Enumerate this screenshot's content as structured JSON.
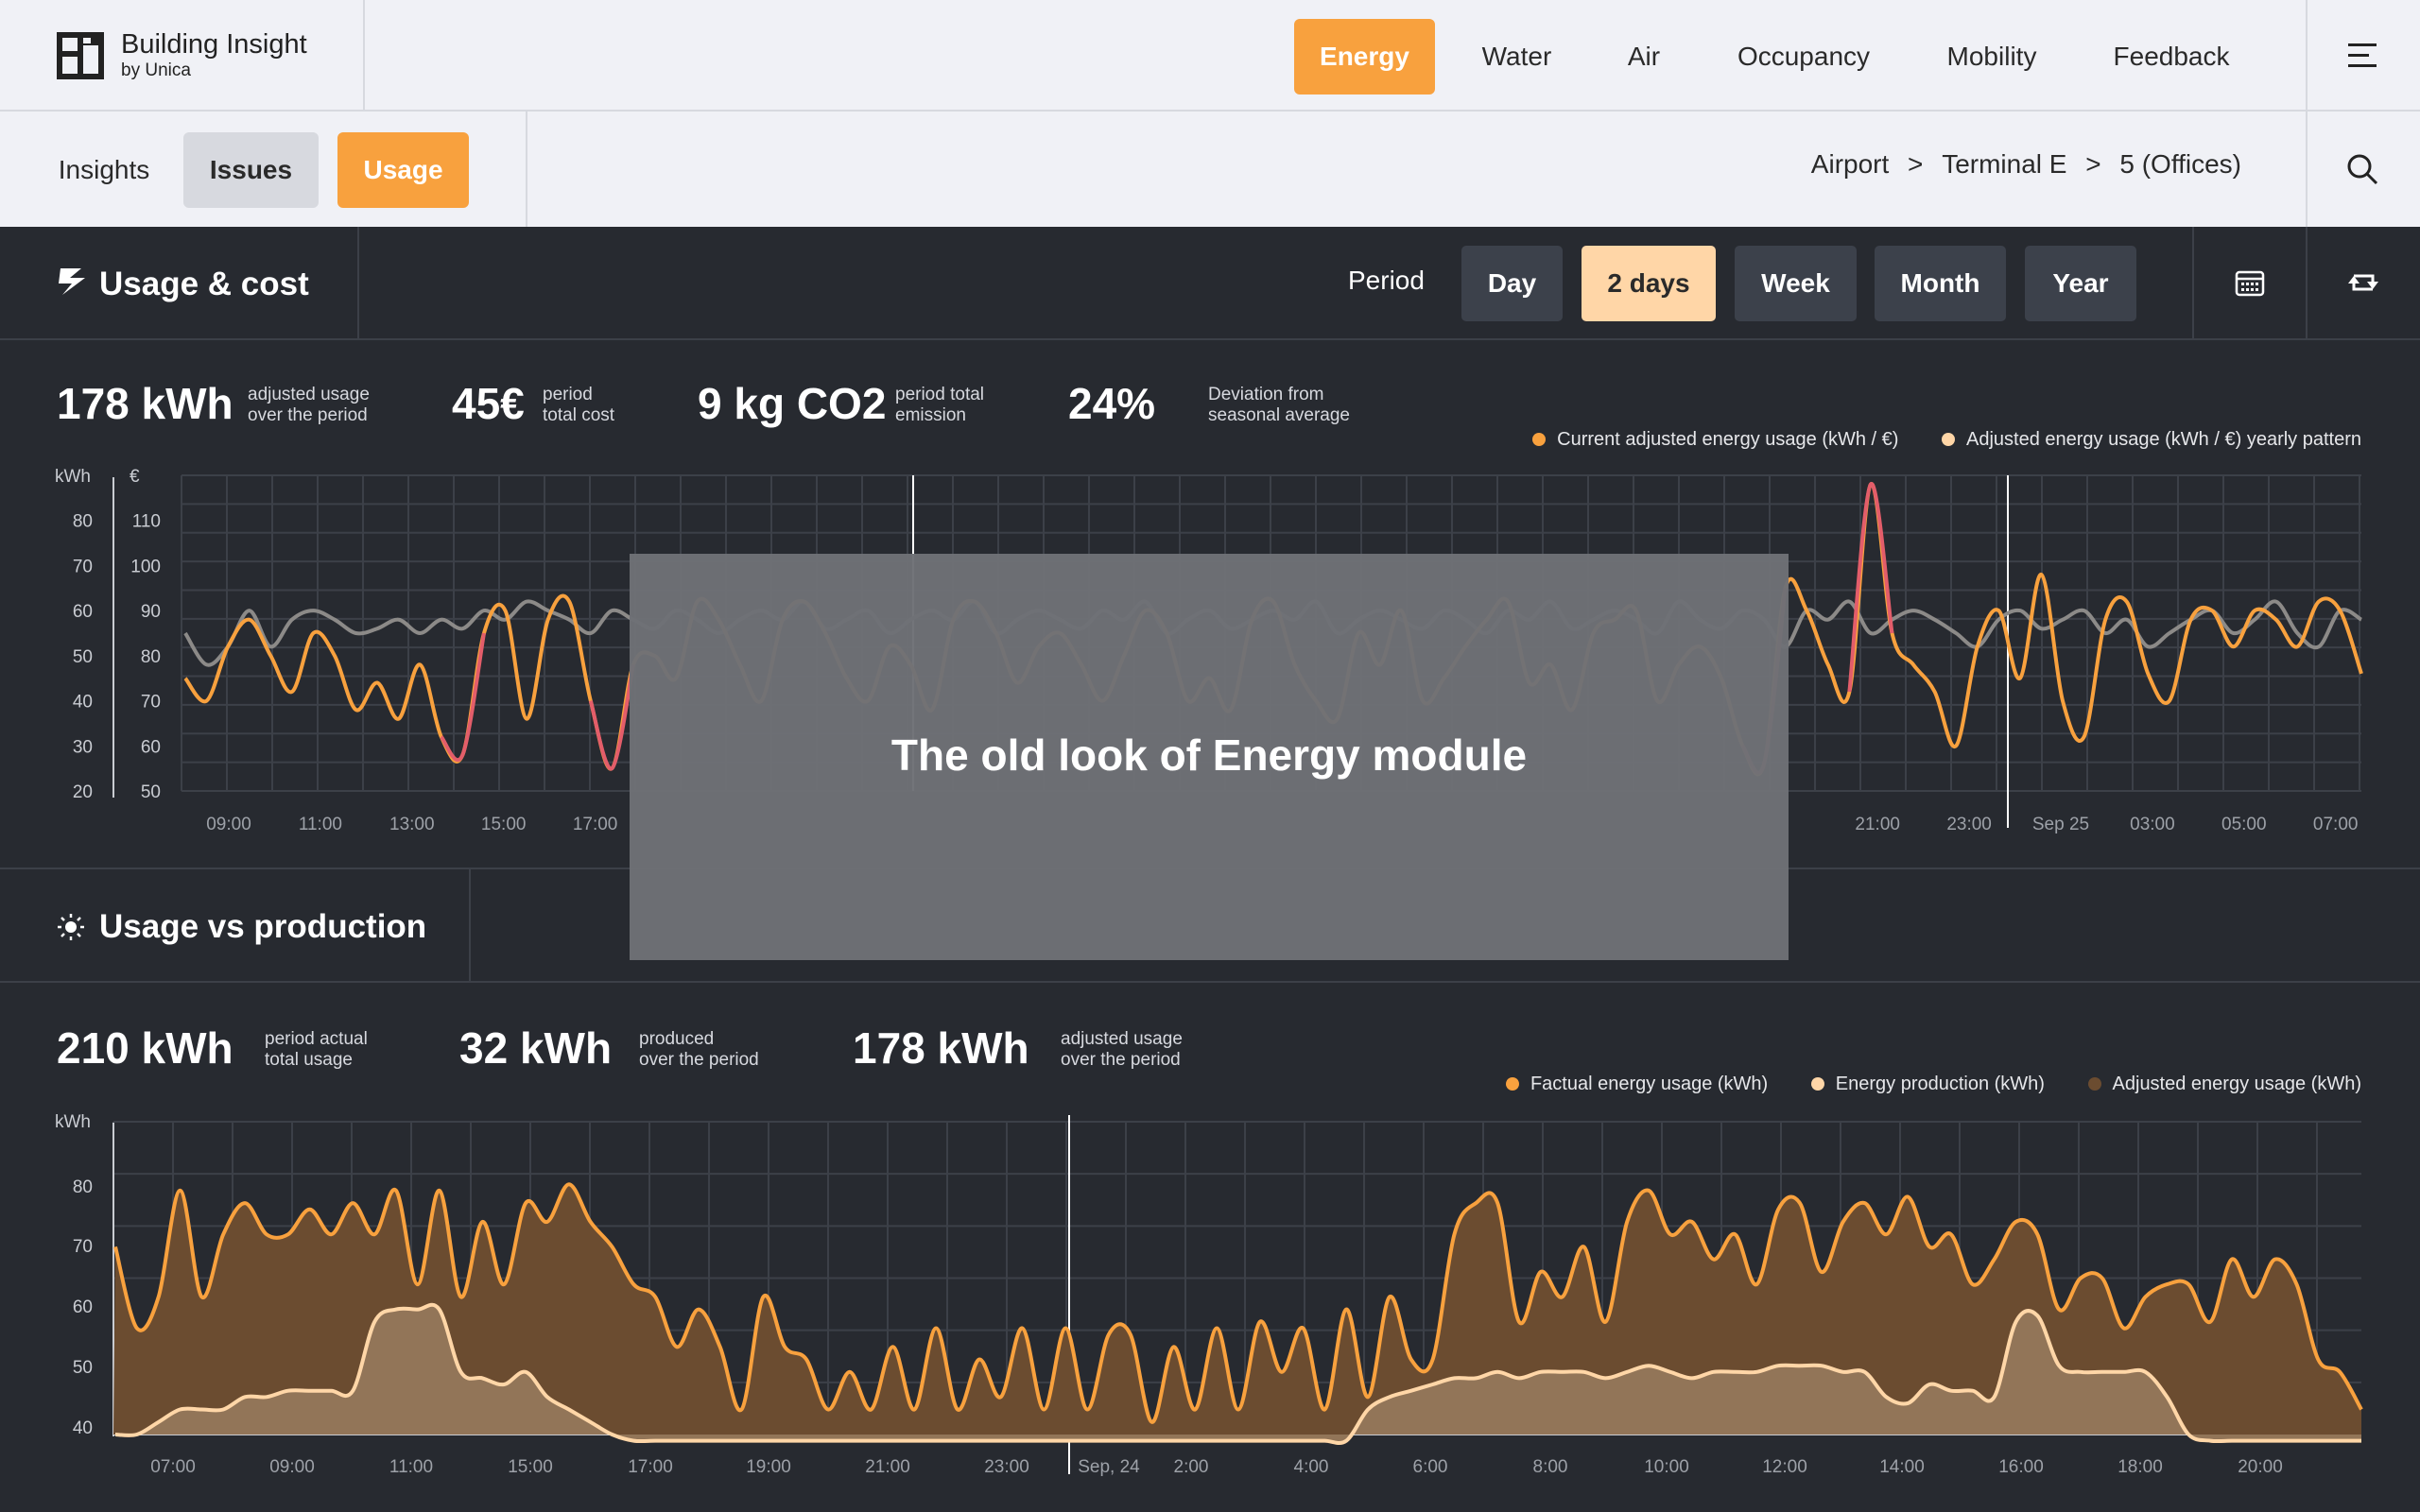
{
  "app": {
    "name": "Building Insight",
    "by": "by Unica"
  },
  "nav": {
    "items": [
      "Energy",
      "Water",
      "Air",
      "Occupancy",
      "Mobility",
      "Feedback"
    ],
    "active": "Energy"
  },
  "subnav": {
    "insights": "Insights",
    "issues": "Issues",
    "usage": "Usage"
  },
  "breadcrumb": {
    "items": [
      "Airport",
      "Terminal E",
      "5 (Offices)"
    ],
    "sep": ">"
  },
  "usage_cost": {
    "title": "Usage & cost",
    "period_label": "Period",
    "periods": [
      "Day",
      "2 days",
      "Week",
      "Month",
      "Year"
    ],
    "active_period": "2 days",
    "kpis": [
      {
        "value": "178 kWh",
        "label1": "adjusted usage",
        "label2": "over the period"
      },
      {
        "value": "45€",
        "label1": "period",
        "label2": "total cost"
      },
      {
        "value": "9 kg CO2",
        "label1": "period total",
        "label2": "emission"
      },
      {
        "value": "24%",
        "label1": "Deviation from",
        "label2": "seasonal average"
      }
    ],
    "legend": [
      "Current adjusted energy usage (kWh / €)",
      "Adjusted energy usage (kWh / €) yearly pattern"
    ]
  },
  "usage_production": {
    "title": "Usage vs production",
    "kpis": [
      {
        "value": "210 kWh",
        "label1": "period actual",
        "label2": "total usage"
      },
      {
        "value": "32 kWh",
        "label1": "produced",
        "label2": "over the period"
      },
      {
        "value": "178 kWh",
        "label1": "adjusted usage",
        "label2": "over the period"
      }
    ],
    "legend": [
      "Factual energy usage (kWh)",
      "Energy production (kWh)",
      "Adjusted energy usage (kWh)"
    ]
  },
  "overlay": {
    "text": "The old look of Energy module"
  },
  "colors": {
    "accent": "#f8a13e",
    "accent_light": "#ffd6a7",
    "pattern": "#8c8a88",
    "peak": "#e35d6a",
    "bg": "#272a30"
  },
  "chart_data": [
    {
      "type": "line",
      "y_units": [
        "kWh",
        "€"
      ],
      "y_ticks_kwh": [
        80,
        70,
        60,
        50,
        40,
        30,
        20
      ],
      "y_ticks_eur": [
        110,
        100,
        90,
        80,
        70,
        60,
        50
      ],
      "ylim": [
        20,
        90
      ],
      "x_ticks": [
        "09:00",
        "11:00",
        "13:00",
        "15:00",
        "17:00",
        "",
        "",
        "",
        "",
        "",
        "",
        "",
        "",
        "",
        "",
        "",
        "",
        "",
        "21:00",
        "23:00",
        "Sep 25",
        "03:00",
        "05:00",
        "07:00"
      ],
      "series": [
        {
          "name": "Current adjusted energy usage (kWh / €)",
          "values": [
            45,
            40,
            52,
            58,
            50,
            42,
            55,
            50,
            38,
            44,
            36,
            48,
            32,
            28,
            55,
            60,
            36,
            58,
            62,
            40,
            25,
            48,
            50,
            45,
            62,
            58,
            48,
            40,
            58,
            62,
            55,
            45,
            40,
            52,
            48,
            38,
            58,
            62,
            55,
            44,
            52,
            55,
            48,
            40,
            50,
            60,
            55,
            40,
            45,
            38,
            58,
            62,
            48,
            40,
            36,
            55,
            48,
            60,
            40,
            45,
            52,
            58,
            62,
            44,
            48,
            38,
            55,
            58,
            60,
            40,
            48,
            52,
            45,
            30,
            26,
            65,
            60,
            48,
            42,
            88,
            55,
            48,
            42,
            30,
            52,
            60,
            45,
            68,
            40,
            32,
            58,
            62,
            46,
            40,
            58,
            60,
            52,
            60,
            58,
            52,
            62,
            60,
            46
          ]
        },
        {
          "name": "Adjusted energy usage (kWh / €) yearly pattern",
          "values": [
            55,
            48,
            52,
            60,
            52,
            58,
            60,
            58,
            55,
            56,
            58,
            55,
            58,
            56,
            60,
            58,
            62,
            60,
            58,
            55,
            60,
            58,
            56,
            60,
            58,
            55,
            58,
            60,
            58,
            62,
            56,
            58,
            60,
            55,
            58,
            60,
            58,
            62,
            55,
            58,
            60,
            58,
            56,
            60,
            58,
            62,
            55,
            58,
            60,
            56,
            58,
            60,
            58,
            62,
            55,
            58,
            60,
            58,
            56,
            60,
            58,
            55,
            60,
            58,
            62,
            56,
            58,
            60,
            58,
            55,
            62,
            58,
            56,
            60,
            58,
            52,
            60,
            58,
            62,
            55,
            58,
            60,
            58,
            55,
            52,
            58,
            60,
            56,
            58,
            60,
            55,
            58,
            52,
            55,
            58,
            60,
            55,
            58,
            62,
            55,
            52,
            60,
            58
          ]
        }
      ]
    },
    {
      "type": "area",
      "y_unit": "kWh",
      "y_ticks": [
        80,
        70,
        60,
        50,
        40
      ],
      "ylim": [
        38,
        88
      ],
      "x_ticks": [
        "07:00",
        "09:00",
        "11:00",
        "15:00",
        "17:00",
        "19:00",
        "21:00",
        "23:00",
        "Sep, 24",
        "2:00",
        "4:00",
        "6:00",
        "8:00",
        "10:00",
        "12:00",
        "14:00",
        "16:00",
        "18:00",
        "20:00"
      ],
      "series": [
        {
          "name": "Factual energy usage (kWh)",
          "values": [
            68,
            55,
            60,
            77,
            60,
            70,
            75,
            70,
            70,
            74,
            70,
            75,
            70,
            77,
            62,
            77,
            60,
            72,
            62,
            75,
            72,
            78,
            72,
            68,
            62,
            60,
            52,
            58,
            52,
            42,
            60,
            52,
            50,
            42,
            48,
            42,
            52,
            42,
            55,
            42,
            50,
            44,
            55,
            42,
            55,
            42,
            54,
            54,
            40,
            52,
            42,
            55,
            42,
            56,
            48,
            55,
            42,
            58,
            44,
            60,
            50,
            50,
            70,
            75,
            75,
            56,
            64,
            60,
            68,
            56,
            72,
            77,
            70,
            72,
            66,
            70,
            62,
            74,
            75,
            64,
            72,
            75,
            70,
            76,
            68,
            70,
            62,
            66,
            72,
            70,
            58,
            63,
            63,
            55,
            60,
            62,
            62,
            56,
            66,
            60,
            66,
            62,
            50,
            48,
            42
          ]
        },
        {
          "name": "Energy production (kWh)",
          "values": [
            38,
            38,
            40,
            42,
            42,
            42,
            44,
            44,
            45,
            45,
            45,
            45,
            56,
            58,
            58,
            58,
            48,
            47,
            46,
            48,
            44,
            42,
            40,
            38,
            37,
            37,
            37,
            37,
            37,
            37,
            37,
            37,
            37,
            37,
            37,
            37,
            37,
            37,
            37,
            37,
            37,
            37,
            37,
            37,
            37,
            37,
            37,
            37,
            37,
            37,
            37,
            37,
            37,
            37,
            37,
            37,
            37,
            37,
            42,
            44,
            45,
            46,
            47,
            47,
            48,
            47,
            48,
            48,
            48,
            47,
            48,
            49,
            48,
            47,
            48,
            48,
            48,
            49,
            49,
            49,
            48,
            48,
            44,
            43,
            46,
            45,
            45,
            44,
            56,
            57,
            49,
            48,
            48,
            48,
            48,
            44,
            38,
            37,
            37,
            37,
            37,
            37,
            37,
            37,
            37
          ]
        }
      ]
    }
  ]
}
